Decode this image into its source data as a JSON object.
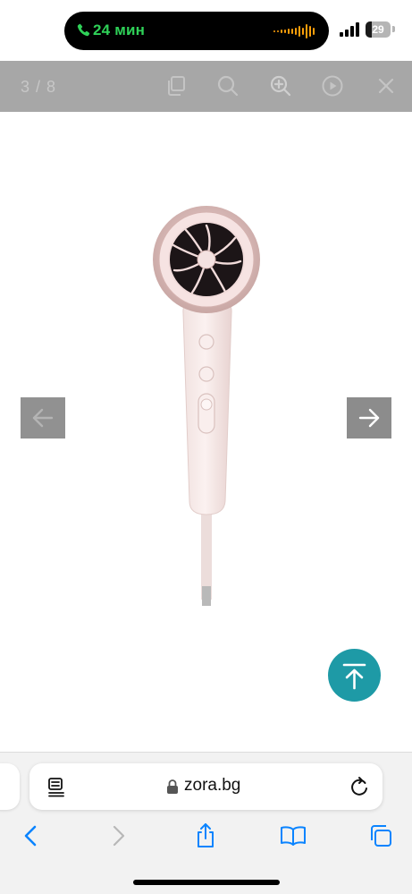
{
  "status_bar": {
    "call_time": "24 мин",
    "battery_level": "29",
    "colors": {
      "call_green": "#2fd158",
      "wave_orange": "#ff9f0a"
    }
  },
  "lightbox": {
    "counter": "3 / 8",
    "toolbar_icons": [
      "copy-icon",
      "zoom-out-icon",
      "zoom-in-icon",
      "play-icon",
      "close-icon"
    ],
    "toolbar_color": "#a7a7a7",
    "image_subject": "hair-dryer",
    "prev_arrow_icon": "arrow-left-icon",
    "next_arrow_icon": "arrow-right-icon"
  },
  "page": {
    "scroll_top_icon": "arrow-up-to-line-icon",
    "accent": "#1e9aa6"
  },
  "browser": {
    "url": "zora.bg",
    "nav_icons": [
      "back-icon",
      "forward-icon",
      "share-icon",
      "bookmarks-icon",
      "tabs-icon"
    ],
    "accent": "#0a84ff"
  }
}
